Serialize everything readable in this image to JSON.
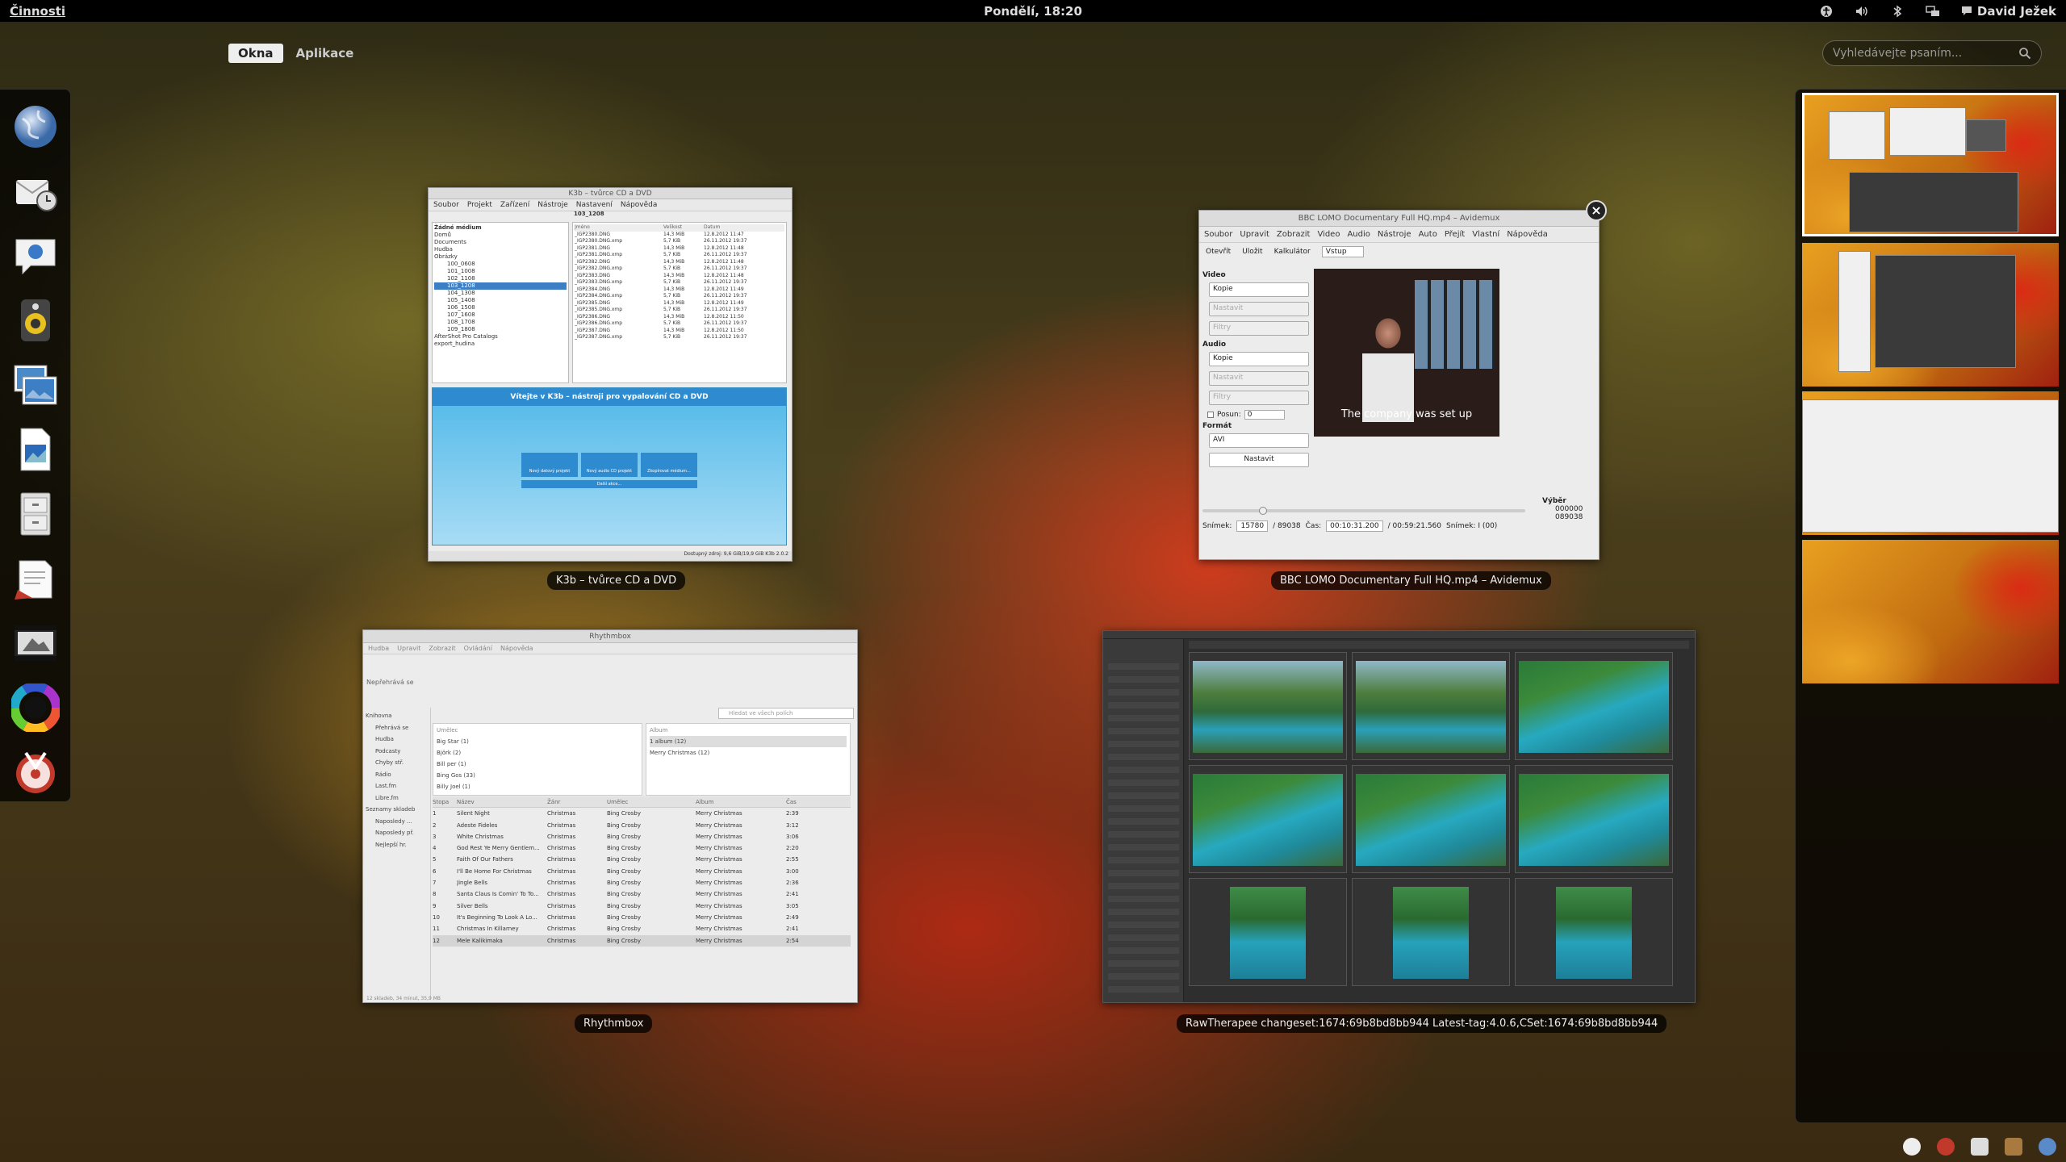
{
  "topbar": {
    "activities": "Činnosti",
    "clock": "Pondělí, 18:20",
    "user": "David Ježek"
  },
  "view_switcher": {
    "windows": "Okna",
    "applications": "Aplikace"
  },
  "search": {
    "placeholder": "Vyhledávejte psaním..."
  },
  "dash": {
    "items": [
      "web-browser",
      "evolution-mail",
      "empathy-chat",
      "rhythmbox",
      "image-viewer",
      "libreoffice-draw",
      "file-manager",
      "text-editor",
      "video-editor",
      "color-manager",
      "k3b"
    ]
  },
  "windows": {
    "k3b": {
      "title": "K3b – tvůrce CD a DVD",
      "inner_title": "K3b – tvůrce CD a DVD",
      "menu": [
        "Soubor",
        "Projekt",
        "Zařízení",
        "Nástroje",
        "Nastavení",
        "Nápověda"
      ],
      "tree": [
        "Žádné médium",
        "Domů",
        "Documents",
        "Hudba",
        "Obrázky",
        "100_0608",
        "101_1008",
        "102_1108",
        "103_1208",
        "104_1308",
        "105_1408",
        "106_1508",
        "107_1608",
        "108_1708",
        "109_1808",
        "AfterShot Pro Catalogs",
        "export_hudina"
      ],
      "path": "103_1208",
      "list_header": [
        "Jméno",
        "Velikost",
        "Datum"
      ],
      "files": [
        [
          "_IGP2380.DNG",
          "14,3 MiB",
          "12.8.2012 11:47"
        ],
        [
          "_IGP2380.DNG.xmp",
          "5,7 KiB",
          "26.11.2012 19:37"
        ],
        [
          "_IGP2381.DNG",
          "14,3 MiB",
          "12.8.2012 11:48"
        ],
        [
          "_IGP2381.DNG.xmp",
          "5,7 KiB",
          "26.11.2012 19:37"
        ],
        [
          "_IGP2382.DNG",
          "14,3 MiB",
          "12.8.2012 11:48"
        ],
        [
          "_IGP2382.DNG.xmp",
          "5,7 KiB",
          "26.11.2012 19:37"
        ],
        [
          "_IGP2383.DNG",
          "14,3 MiB",
          "12.8.2012 11:48"
        ],
        [
          "_IGP2383.DNG.xmp",
          "5,7 KiB",
          "26.11.2012 19:37"
        ],
        [
          "_IGP2384.DNG",
          "14,3 MiB",
          "12.8.2012 11:49"
        ],
        [
          "_IGP2384.DNG.xmp",
          "5,7 KiB",
          "26.11.2012 19:37"
        ],
        [
          "_IGP2385.DNG",
          "14,3 MiB",
          "12.8.2012 11:49"
        ],
        [
          "_IGP2385.DNG.xmp",
          "5,7 KiB",
          "26.11.2012 19:37"
        ],
        [
          "_IGP2386.DNG",
          "14,3 MiB",
          "12.8.2012 11:50"
        ],
        [
          "_IGP2386.DNG.xmp",
          "5,7 KiB",
          "26.11.2012 19:37"
        ],
        [
          "_IGP2387.DNG",
          "14,3 MiB",
          "12.8.2012 11:50"
        ],
        [
          "_IGP2387.DNG.xmp",
          "5,7 KiB",
          "26.11.2012 19:37"
        ]
      ],
      "welcome": "Vítejte v K3b – nástroji pro vypalování CD a DVD",
      "buttons": [
        "Nový datový projekt",
        "Nový audio CD projekt",
        "Zkopírovat médium..."
      ],
      "more_actions": "Další akce...",
      "status": "Dostupný zdroj: 9,6 GiB/19,9 GiB   K3b 2.0.2"
    },
    "avidemux": {
      "title": "BBC LOMO Documentary Full HQ.mp4 – Avidemux",
      "inner_title": "BBC LOMO Documentary Full HQ.mp4 – Avidemux",
      "menu": [
        "Soubor",
        "Upravit",
        "Zobrazit",
        "Video",
        "Audio",
        "Nástroje",
        "Auto",
        "Přejít",
        "Vlastní",
        "Nápověda"
      ],
      "toolbar": [
        "Otevřít",
        "Uložit",
        "Kalkulátor"
      ],
      "input_select": "Vstup",
      "video_label": "Video",
      "audio_label": "Audio",
      "format_label": "Formát",
      "copy": "Kopie",
      "configure": "Nastavit",
      "filters": "Filtry",
      "shift_label": "Posun:",
      "shift_value": "0",
      "format_value": "AVI",
      "subtitle": "The company was set up",
      "frame_label": "Snímek:",
      "frame_value": "15780",
      "frame_total": "/ 89038",
      "time_label": "Čas:",
      "time_value": "00:10:31.200",
      "time_total": "/ 00:59:21.560",
      "frame_type": "Snímek: I (00)",
      "selection_label": "Výběr",
      "sel_a": "000000",
      "sel_b": "089038"
    },
    "rhythmbox": {
      "title": "Rhythmbox",
      "inner_title": "Rhythmbox",
      "menu": [
        "Hudba",
        "Upravit",
        "Zobrazit",
        "Ovládání",
        "Nápověda"
      ],
      "not_playing": "Nepřehrává se",
      "sidebar": [
        "Knihovna",
        "Přehrává se",
        "Hudba",
        "Podcasty",
        "Chyby stř.",
        "Rádio",
        "Last.fm",
        "Libre.fm",
        "Seznamy skladeb",
        "Naposledy ...",
        "Naposledy př.",
        "Nejlepší hr."
      ],
      "artists_header": "Umělec",
      "artists": [
        "Big Star (1)",
        "Björk (2)",
        "Bill per (1)",
        "Bing Gos (33)",
        "Billy Joel (1)"
      ],
      "album_header": "Album",
      "albums": [
        "1 album (12)",
        "Merry Christmas (12)"
      ],
      "search_placeholder": "Hledat ve všech polích",
      "columns": [
        "Stopa",
        "Název",
        "Žánr",
        "Umělec",
        "Album",
        "Čas"
      ],
      "tracks": [
        [
          "1",
          "Silent Night",
          "Christmas",
          "Bing Crosby",
          "Merry Christmas",
          "2:39"
        ],
        [
          "2",
          "Adeste Fideles",
          "Christmas",
          "Bing Crosby",
          "Merry Christmas",
          "3:12"
        ],
        [
          "3",
          "White Christmas",
          "Christmas",
          "Bing Crosby",
          "Merry Christmas",
          "3:06"
        ],
        [
          "4",
          "God Rest Ye Merry Gentlem...",
          "Christmas",
          "Bing Crosby",
          "Merry Christmas",
          "2:20"
        ],
        [
          "5",
          "Faith Of Our Fathers",
          "Christmas",
          "Bing Crosby",
          "Merry Christmas",
          "2:55"
        ],
        [
          "6",
          "I'll Be Home For Christmas",
          "Christmas",
          "Bing Crosby",
          "Merry Christmas",
          "3:00"
        ],
        [
          "7",
          "Jingle Bells",
          "Christmas",
          "Bing Crosby",
          "Merry Christmas",
          "2:36"
        ],
        [
          "8",
          "Santa Claus Is Comin' To To...",
          "Christmas",
          "Bing Crosby",
          "Merry Christmas",
          "2:41"
        ],
        [
          "9",
          "Silver Bells",
          "Christmas",
          "Bing Crosby",
          "Merry Christmas",
          "3:05"
        ],
        [
          "10",
          "It's Beginning To Look A Lo...",
          "Christmas",
          "Bing Crosby",
          "Merry Christmas",
          "2:49"
        ],
        [
          "11",
          "Christmas In Killarney",
          "Christmas",
          "Bing Crosby",
          "Merry Christmas",
          "2:41"
        ],
        [
          "12",
          "Mele Kalikimaka",
          "Christmas",
          "Bing Crosby",
          "Merry Christmas",
          "2:54"
        ]
      ],
      "status": "12 skladeb, 34 minut, 35,9 MB"
    },
    "rawtherapee": {
      "title": "RawTherapee changeset:1674:69b8bd8bb944 Latest-tag:4.0.6,CSet:1674:69b8bd8bb944"
    }
  },
  "colors": {
    "topbar": "#000000",
    "overlay": "#000000",
    "k3b_blue": "#2e8bd0"
  }
}
